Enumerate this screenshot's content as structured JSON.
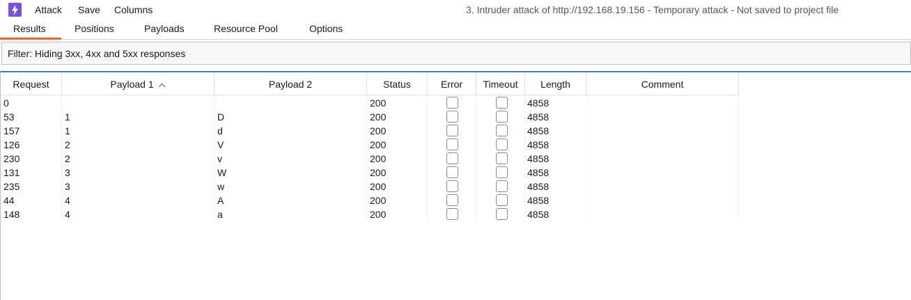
{
  "app": {
    "icon": "burp-lightning-icon",
    "accent_color": "#7b4fe0"
  },
  "menu": {
    "attack": "Attack",
    "save": "Save",
    "columns": "Columns"
  },
  "window_title": "3. Intruder attack of http://192.168.19.156 - Temporary attack - Not saved to project file",
  "tabs": [
    {
      "label": "Results",
      "active": true
    },
    {
      "label": "Positions",
      "active": false
    },
    {
      "label": "Payloads",
      "active": false
    },
    {
      "label": "Resource Pool",
      "active": false
    },
    {
      "label": "Options",
      "active": false
    }
  ],
  "active_tab_color": "#e8652a",
  "filter": {
    "text": "Filter: Hiding 3xx, 4xx and 5xx responses"
  },
  "table": {
    "columns": [
      "Request",
      "Payload 1",
      "Payload 2",
      "Status",
      "Error",
      "Timeout",
      "Length",
      "Comment"
    ],
    "sorted_column": "Payload 1",
    "sort_direction": "ascending",
    "rows": [
      {
        "request": "0",
        "payload1": "",
        "payload2": "",
        "status": "200",
        "error": false,
        "timeout": false,
        "length": "4858",
        "comment": ""
      },
      {
        "request": "53",
        "payload1": "1",
        "payload2": "D",
        "status": "200",
        "error": false,
        "timeout": false,
        "length": "4858",
        "comment": ""
      },
      {
        "request": "157",
        "payload1": "1",
        "payload2": "d",
        "status": "200",
        "error": false,
        "timeout": false,
        "length": "4858",
        "comment": ""
      },
      {
        "request": "126",
        "payload1": "2",
        "payload2": "V",
        "status": "200",
        "error": false,
        "timeout": false,
        "length": "4858",
        "comment": ""
      },
      {
        "request": "230",
        "payload1": "2",
        "payload2": "v",
        "status": "200",
        "error": false,
        "timeout": false,
        "length": "4858",
        "comment": ""
      },
      {
        "request": "131",
        "payload1": "3",
        "payload2": "W",
        "status": "200",
        "error": false,
        "timeout": false,
        "length": "4858",
        "comment": ""
      },
      {
        "request": "235",
        "payload1": "3",
        "payload2": "w",
        "status": "200",
        "error": false,
        "timeout": false,
        "length": "4858",
        "comment": ""
      },
      {
        "request": "44",
        "payload1": "4",
        "payload2": "A",
        "status": "200",
        "error": false,
        "timeout": false,
        "length": "4858",
        "comment": ""
      },
      {
        "request": "148",
        "payload1": "4",
        "payload2": "a",
        "status": "200",
        "error": false,
        "timeout": false,
        "length": "4858",
        "comment": ""
      }
    ]
  }
}
